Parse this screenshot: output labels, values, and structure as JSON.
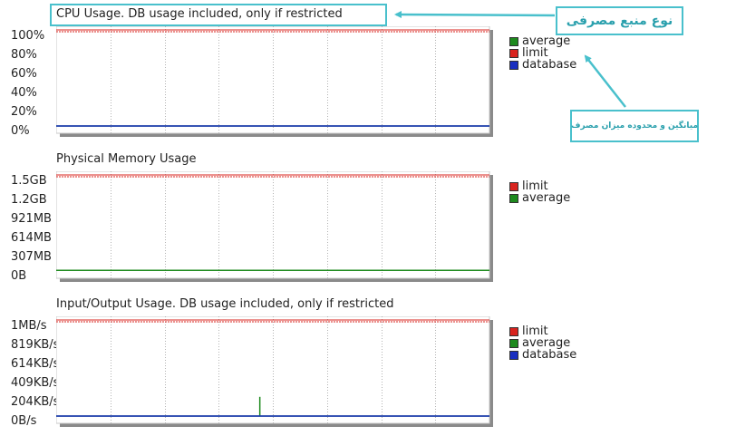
{
  "colors": {
    "limit": "#d9241f",
    "average": "#1e8a1e",
    "database": "#1a2fc0",
    "grid": "#b3b3b3",
    "callout": "#49c0cc",
    "callout_text": "#2aa0ad"
  },
  "annotations": {
    "resource_type_label": "نوع منبع مصرفی",
    "legend_note_label": "میانگین و محدوده میزان مصرف"
  },
  "chart_data": [
    {
      "type": "line",
      "title": "CPU Usage. DB usage included, only if restricted",
      "y_tick_labels": [
        "100%",
        "80%",
        "60%",
        "40%",
        "20%",
        "0%"
      ],
      "ylim": [
        0,
        100
      ],
      "grid": true,
      "legend_position": "right",
      "series": [
        {
          "name": "average",
          "constant": 0,
          "spikes": []
        },
        {
          "name": "limit",
          "constant": 100,
          "spikes": []
        },
        {
          "name": "database",
          "constant": 0,
          "spikes": []
        }
      ]
    },
    {
      "type": "line",
      "title": "Physical Memory Usage",
      "y_tick_labels": [
        "1.5GB",
        "1.2GB",
        "921MB",
        "614MB",
        "307MB",
        "0B"
      ],
      "ylim": [
        0,
        1.5
      ],
      "grid": true,
      "legend_position": "right",
      "series": [
        {
          "name": "limit",
          "constant": 1.5,
          "spikes": []
        },
        {
          "name": "average",
          "constant": 0.01,
          "spikes": []
        }
      ]
    },
    {
      "type": "line",
      "title": "Input/Output Usage. DB usage included, only if restricted",
      "y_tick_labels": [
        "1MB/s",
        "819KB/s",
        "614KB/s",
        "409KB/s",
        "204KB/s",
        "0B/s"
      ],
      "ylim": [
        0,
        1
      ],
      "grid": true,
      "legend_position": "right",
      "series": [
        {
          "name": "limit",
          "constant": 1,
          "spikes": []
        },
        {
          "name": "average",
          "constant": 0,
          "spikes": [
            {
              "t": 0.47,
              "v": 0.2
            }
          ]
        },
        {
          "name": "database",
          "constant": 0,
          "spikes": []
        }
      ]
    }
  ]
}
